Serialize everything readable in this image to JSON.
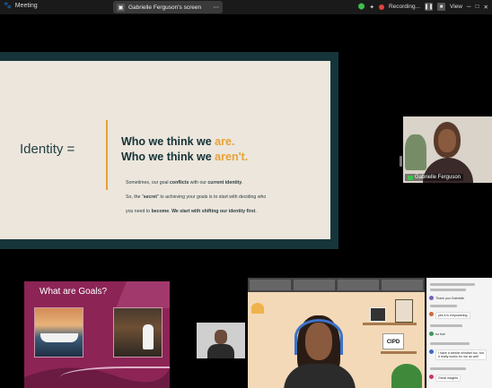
{
  "topbar": {
    "app_label": "Meeting",
    "share_label": "Gabrielle Ferguson's screen",
    "recording_label": "Recording...",
    "view_label": "View"
  },
  "slide": {
    "identity": "Identity =",
    "headline_line1": "Who we think we ",
    "headline_hi1": "are.",
    "headline_line2": "Who we think we ",
    "headline_hi2": "aren't.",
    "body_line1_pre": "Sometimes, our goal ",
    "body_line1_b1": "conflicts",
    "body_line1_mid": " with our ",
    "body_line1_b2": "current identity",
    "body_line1_post": ".",
    "body_line2_pre": "So, the \"",
    "body_line2_b": "secret",
    "body_line2_post": "\" to achieving your goals is to start with deciding who",
    "body_line3_pre": "you need to ",
    "body_line3_b1": "become",
    "body_line3_mid": ". ",
    "body_line3_b2": "We start with shifting our identity first",
    "body_line3_post": ".",
    "accent_color": "#e7a235"
  },
  "speaker": {
    "name": "Gabrielle Ferguson"
  },
  "goals_slide": {
    "title": "What are Goals?"
  },
  "presenter": {
    "badge": "CIPD"
  },
  "chat": {
    "messages": [
      "Thank you Gabrielle",
      "yes it is empowering",
      "so true",
      "I have a similar mindset too, but",
      "it really works for me as well",
      "Great insights"
    ]
  }
}
